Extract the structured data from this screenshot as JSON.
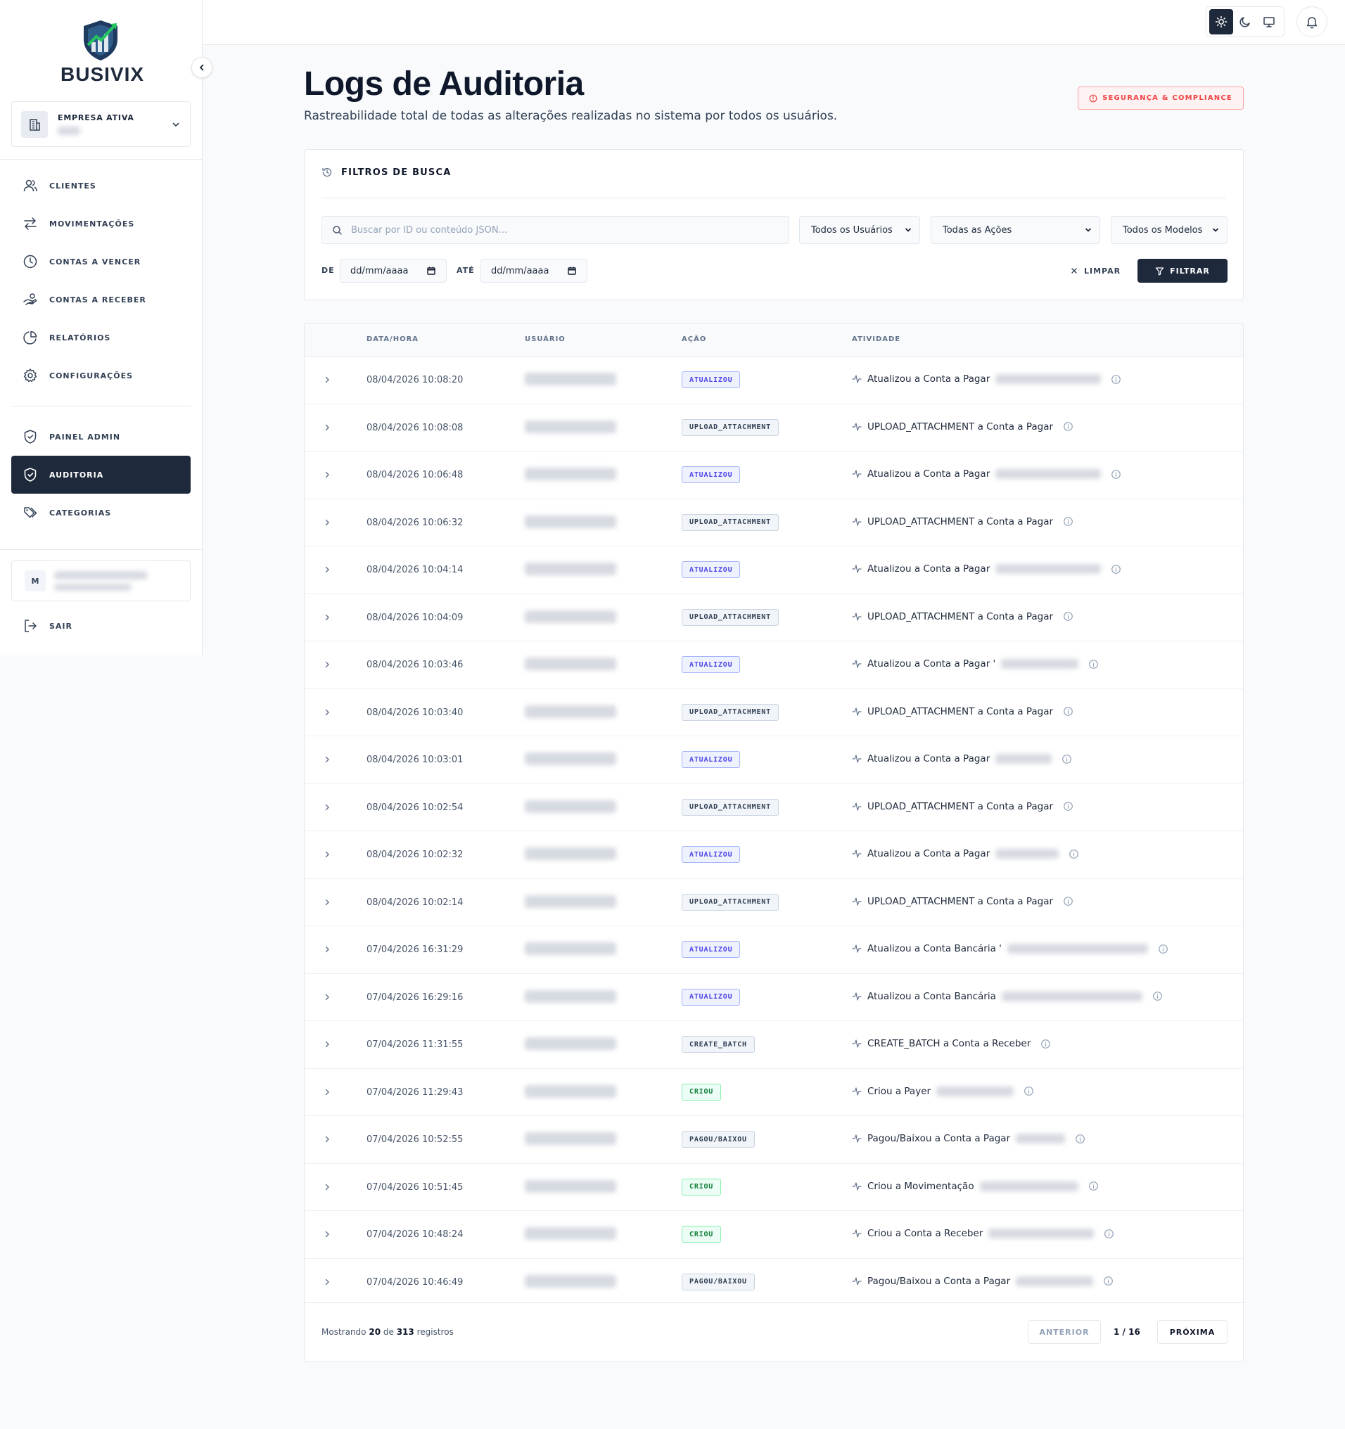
{
  "app": {
    "brand": "BUSIVIX"
  },
  "company": {
    "label": "EMPRESA ATIVA"
  },
  "sidebar": {
    "items": [
      {
        "label": "CLIENTES",
        "icon": "users-icon"
      },
      {
        "label": "MOVIMENTAÇÕES",
        "icon": "arrows-left-right-icon"
      },
      {
        "label": "CONTAS A VENCER",
        "icon": "clock-icon"
      },
      {
        "label": "CONTAS A RECEBER",
        "icon": "hand-coins-icon"
      },
      {
        "label": "RELATÓRIOS",
        "icon": "pie-chart-icon"
      },
      {
        "label": "CONFIGURAÇÕES",
        "icon": "gear-icon"
      }
    ],
    "admin_items": [
      {
        "label": "PAINEL ADMIN",
        "icon": "shield-icon"
      },
      {
        "label": "AUDITORIA",
        "icon": "shield-check-icon",
        "active": true
      },
      {
        "label": "CATEGORIAS",
        "icon": "tags-icon"
      }
    ],
    "user_initial": "M",
    "logout": "SAIR"
  },
  "header": {
    "title": "Logs de Auditoria",
    "subtitle": "Rastreabilidade total de todas as alterações realizadas no sistema por todos os usuários.",
    "badge": "SEGURANÇA & COMPLIANCE",
    "theme_active": "light"
  },
  "filters": {
    "title": "FILTROS DE BUSCA",
    "search_placeholder": "Buscar por ID ou conteúdo JSON...",
    "users_select": "Todos os Usuários",
    "actions_select": "Todas as Ações",
    "models_select": "Todos os Modelos",
    "from_label": "DE",
    "to_label": "ATÉ",
    "date_placeholder": "dd/mm/aaaa",
    "clear": "LIMPAR",
    "apply": "FILTRAR"
  },
  "table": {
    "columns": [
      "DATA/HORA",
      "USUÁRIO",
      "AÇÃO",
      "ATIVIDADE"
    ],
    "rows": [
      {
        "datetime": "08/04/2026 10:08:20",
        "action": "ATUALIZOU",
        "kind": "upd",
        "activity": "Atualizou a Conta a Pagar"
      },
      {
        "datetime": "08/04/2026 10:08:08",
        "action": "UPLOAD_ATTACHMENT",
        "kind": "neu",
        "activity": "UPLOAD_ATTACHMENT a Conta a Pagar"
      },
      {
        "datetime": "08/04/2026 10:06:48",
        "action": "ATUALIZOU",
        "kind": "upd",
        "activity": "Atualizou a Conta a Pagar"
      },
      {
        "datetime": "08/04/2026 10:06:32",
        "action": "UPLOAD_ATTACHMENT",
        "kind": "neu",
        "activity": "UPLOAD_ATTACHMENT a Conta a Pagar"
      },
      {
        "datetime": "08/04/2026 10:04:14",
        "action": "ATUALIZOU",
        "kind": "upd",
        "activity": "Atualizou a Conta a Pagar"
      },
      {
        "datetime": "08/04/2026 10:04:09",
        "action": "UPLOAD_ATTACHMENT",
        "kind": "neu",
        "activity": "UPLOAD_ATTACHMENT a Conta a Pagar"
      },
      {
        "datetime": "08/04/2026 10:03:46",
        "action": "ATUALIZOU",
        "kind": "upd",
        "activity": "Atualizou a Conta a Pagar '"
      },
      {
        "datetime": "08/04/2026 10:03:40",
        "action": "UPLOAD_ATTACHMENT",
        "kind": "neu",
        "activity": "UPLOAD_ATTACHMENT a Conta a Pagar"
      },
      {
        "datetime": "08/04/2026 10:03:01",
        "action": "ATUALIZOU",
        "kind": "upd",
        "activity": "Atualizou a Conta a Pagar"
      },
      {
        "datetime": "08/04/2026 10:02:54",
        "action": "UPLOAD_ATTACHMENT",
        "kind": "neu",
        "activity": "UPLOAD_ATTACHMENT a Conta a Pagar"
      },
      {
        "datetime": "08/04/2026 10:02:32",
        "action": "ATUALIZOU",
        "kind": "upd",
        "activity": "Atualizou a Conta a Pagar"
      },
      {
        "datetime": "08/04/2026 10:02:14",
        "action": "UPLOAD_ATTACHMENT",
        "kind": "neu",
        "activity": "UPLOAD_ATTACHMENT a Conta a Pagar"
      },
      {
        "datetime": "07/04/2026 16:31:29",
        "action": "ATUALIZOU",
        "kind": "upd",
        "activity": "Atualizou a Conta Bancária '"
      },
      {
        "datetime": "07/04/2026 16:29:16",
        "action": "ATUALIZOU",
        "kind": "upd",
        "activity": "Atualizou a Conta Bancária"
      },
      {
        "datetime": "07/04/2026 11:31:55",
        "action": "CREATE_BATCH",
        "kind": "neu",
        "activity": "CREATE_BATCH a Conta a Receber"
      },
      {
        "datetime": "07/04/2026 11:29:43",
        "action": "CRIOU",
        "kind": "grn",
        "activity": "Criou a Payer"
      },
      {
        "datetime": "07/04/2026 10:52:55",
        "action": "PAGOU/BAIXOU",
        "kind": "neu",
        "activity": "Pagou/Baixou a Conta a Pagar"
      },
      {
        "datetime": "07/04/2026 10:51:45",
        "action": "CRIOU",
        "kind": "grn",
        "activity": "Criou a Movimentação"
      },
      {
        "datetime": "07/04/2026 10:48:24",
        "action": "CRIOU",
        "kind": "grn",
        "activity": "Criou a Conta a Receber"
      },
      {
        "datetime": "07/04/2026 10:46:49",
        "action": "PAGOU/BAIXOU",
        "kind": "neu",
        "activity": "Pagou/Baixou a Conta a Pagar"
      }
    ]
  },
  "pagination": {
    "showing_prefix": "Mostrando",
    "shown": "20",
    "of": "de",
    "total": "313",
    "suffix": "registros",
    "prev": "ANTERIOR",
    "page": "1 / 16",
    "next": "PRÓXIMA"
  },
  "colors": {
    "primary": "#1e293b",
    "danger": "#ef4444",
    "indigo": "#4f46e5",
    "green": "#15803d"
  }
}
